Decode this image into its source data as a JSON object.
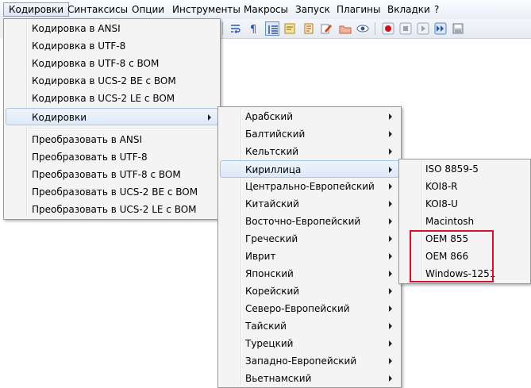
{
  "menubar": {
    "items": [
      {
        "label": "Кодировки",
        "active": true
      },
      {
        "label": "Синтаксисы"
      },
      {
        "label": "Опции"
      },
      {
        "label": "Инструменты"
      },
      {
        "label": "Макросы"
      },
      {
        "label": "Запуск"
      },
      {
        "label": "Плагины"
      },
      {
        "label": "Вкладки"
      },
      {
        "label": "?"
      }
    ]
  },
  "encoding_menu": {
    "group1": [
      "Кодировка в ANSI",
      "Кодировка в UTF-8",
      "Кодировка в UTF-8 с BOM",
      "Кодировка в UCS-2 BE с BOM",
      "Кодировка в UCS-2 LE с BOM"
    ],
    "submenu_label": "Кодировки",
    "group2": [
      "Преобразовать в ANSI",
      "Преобразовать в UTF-8",
      "Преобразовать в UTF-8 с BOM",
      "Преобразовать в UCS-2 BE с BOM",
      "Преобразовать в UCS-2 LE с BOM"
    ]
  },
  "regions_menu": {
    "items": [
      "Арабский",
      "Балтийский",
      "Кельтский",
      "Кириллица",
      "Центрально-Европейский",
      "Китайский",
      "Восточно-Европейский",
      "Греческий",
      "Иврит",
      "Японский",
      "Корейский",
      "Северо-Европейский",
      "Тайский",
      "Турецкий",
      "Западно-Европейский",
      "Вьетнамский"
    ],
    "highlighted": "Кириллица"
  },
  "cyrillic_menu": {
    "items": [
      "ISO 8859-5",
      "KOI8-R",
      "KOI8-U",
      "Macintosh",
      "OEM 855",
      "OEM 866",
      "Windows-1251"
    ],
    "emphasized": [
      "OEM 855",
      "OEM 866",
      "Windows-1251"
    ]
  },
  "colors": {
    "highlight_border": "#d4122c",
    "menu_bg": "#f4f4f4",
    "hover_bg": "#dde9f8"
  }
}
